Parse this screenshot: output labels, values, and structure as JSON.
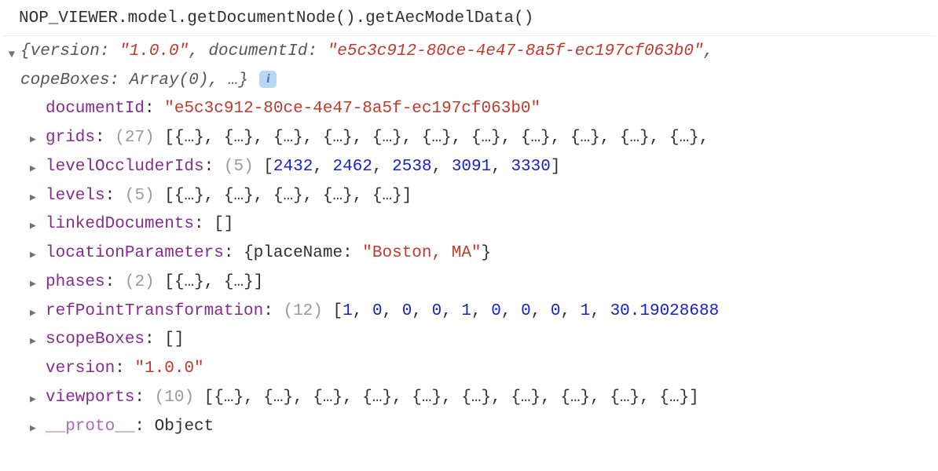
{
  "input_expression": "NOP_VIEWER.model.getDocumentNode().getAecModelData()",
  "summary": {
    "line1_pre": "{version: ",
    "version_val": "\"1.0.0\"",
    "line1_mid": ", documentId: ",
    "docid_val": "\"e5c3c912-80ce-4e47-8a5f-ec197cf063b0\"",
    "line1_end": ",",
    "line2": "copeBoxes: Array(0), …}"
  },
  "props": {
    "documentId": {
      "key": "documentId",
      "colon": ": ",
      "val": "\"e5c3c912-80ce-4e47-8a5f-ec197cf063b0\""
    },
    "grids": {
      "key": "grids",
      "colon": ": ",
      "count": "(27)",
      "body": " [{…}, {…}, {…}, {…}, {…}, {…}, {…}, {…}, {…}, {…}, {…},"
    },
    "levelOccluderIds": {
      "key": "levelOccluderIds",
      "colon": ": ",
      "count": "(5)",
      "open": " [",
      "close": "]",
      "v": [
        "2432",
        "2462",
        "2538",
        "3091",
        "3330"
      ]
    },
    "levels": {
      "key": "levels",
      "colon": ": ",
      "count": "(5)",
      "body": " [{…}, {…}, {…}, {…}, {…}]"
    },
    "linkedDocuments": {
      "key": "linkedDocuments",
      "colon": ": ",
      "body": "[]"
    },
    "locationParameters": {
      "key": "locationParameters",
      "colon": ": ",
      "open": "{placeName: ",
      "val": "\"Boston, MA\"",
      "close": "}"
    },
    "phases": {
      "key": "phases",
      "colon": ": ",
      "count": "(2)",
      "body": " [{…}, {…}]"
    },
    "refPointTransformation": {
      "key": "refPointTransformation",
      "colon": ": ",
      "count": "(12)",
      "open": " [",
      "v": [
        "1",
        "0",
        "0",
        "0",
        "1",
        "0",
        "0",
        "0",
        "1",
        "30.19028688"
      ]
    },
    "scopeBoxes": {
      "key": "scopeBoxes",
      "colon": ": ",
      "body": "[]"
    },
    "version": {
      "key": "version",
      "colon": ": ",
      "val": "\"1.0.0\""
    },
    "viewports": {
      "key": "viewports",
      "colon": ": ",
      "count": "(10)",
      "body": " [{…}, {…}, {…}, {…}, {…}, {…}, {…}, {…}, {…}, {…}]"
    },
    "proto": {
      "key": "__proto__",
      "colon": ": ",
      "body": "Object"
    }
  }
}
